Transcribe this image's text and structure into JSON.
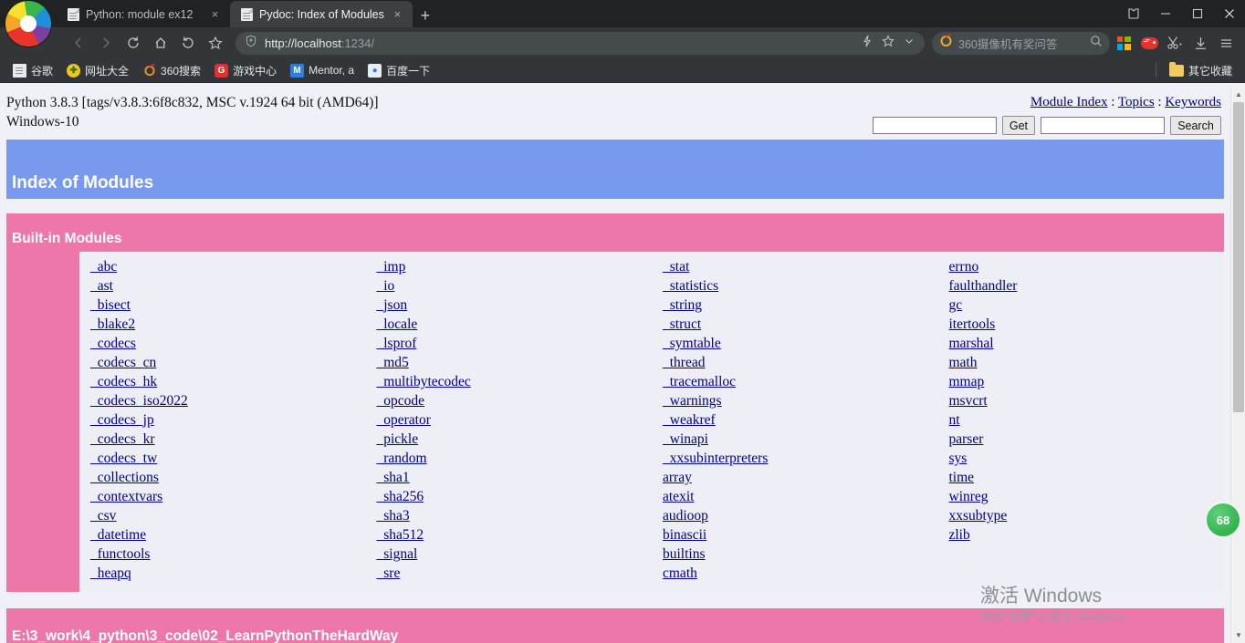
{
  "browser": {
    "tabs": [
      {
        "title": "Python: module ex12",
        "active": false,
        "icon": "document-icon",
        "close_label": "×"
      },
      {
        "title": "Pydoc: Index of Modules",
        "active": true,
        "icon": "document-icon",
        "close_label": "×"
      }
    ],
    "new_tab_label": "+",
    "window_controls": {
      "minimize": "–",
      "maximize": "□",
      "close": "×",
      "collections": "collections-icon"
    },
    "nav": {
      "back": "back-icon",
      "forward": "forward-icon",
      "reload": "reload-icon",
      "home": "home-icon",
      "history": "history-icon",
      "bookmark": "star-icon"
    },
    "omnibox": {
      "shield_icon": "shield-icon",
      "url_protocol": "http://localhost",
      "url_port": ":1234/",
      "full_url": "http://localhost:1234/",
      "right_icons": [
        "lightning-icon",
        "star-icon",
        "chevron-down-icon"
      ]
    },
    "searchbox": {
      "placeholder": "360摄像机有奖问答",
      "engine_icon": "360-search-icon",
      "search_icon": "search-icon"
    },
    "extensions": [
      {
        "name": "microsoft-squares-icon",
        "label": ""
      },
      {
        "name": "game-center-icon",
        "label": ""
      },
      {
        "name": "scissors-icon",
        "label": ""
      },
      {
        "name": "download-icon",
        "label": ""
      },
      {
        "name": "menu-icon",
        "label": ""
      }
    ],
    "bookmarks": [
      {
        "label": "谷歌",
        "icon": "document-icon",
        "color": "#e9eaec"
      },
      {
        "label": "网址大全",
        "icon": "hao123-icon",
        "color": "#f5c518"
      },
      {
        "label": "360搜索",
        "icon": "360-icon",
        "color": "#f58220"
      },
      {
        "label": "游戏中心",
        "icon": "game-icon",
        "color": "#e03030"
      },
      {
        "label": "Mentor, a",
        "icon": "mentor-icon",
        "color": "#2f7fe0"
      },
      {
        "label": "百度一下",
        "icon": "baidu-icon",
        "color": "#3a7fd5"
      }
    ],
    "other_bookmarks": {
      "label": "其它收藏",
      "icon": "folder-icon"
    }
  },
  "content": {
    "version_line1": "Python 3.8.3 [tags/v3.8.3:6f8c832, MSC v.1924 64 bit (AMD64)]",
    "version_line2": "Windows-10",
    "nav_links": [
      {
        "label": "Module Index"
      },
      {
        "label": "Topics"
      },
      {
        "label": "Keywords"
      }
    ],
    "nav_separator": " : ",
    "get_form": {
      "value": "",
      "placeholder": "",
      "button": "Get"
    },
    "search_form": {
      "value": "",
      "placeholder": "",
      "button": "Search"
    },
    "banner_title": "Index of Modules",
    "builtin_section": {
      "title": "Built-in Modules",
      "columns": [
        [
          "_abc",
          "_ast",
          "_bisect",
          "_blake2",
          "_codecs",
          "_codecs_cn",
          "_codecs_hk",
          "_codecs_iso2022",
          "_codecs_jp",
          "_codecs_kr",
          "_codecs_tw",
          "_collections",
          "_contextvars",
          "_csv",
          "_datetime",
          "_functools",
          "_heapq"
        ],
        [
          "_imp",
          "_io",
          "_json",
          "_locale",
          "_lsprof",
          "_md5",
          "_multibytecodec",
          "_opcode",
          "_operator",
          "_pickle",
          "_random",
          "_sha1",
          "_sha256",
          "_sha3",
          "_sha512",
          "_signal",
          "_sre"
        ],
        [
          "_stat",
          "_statistics",
          "_string",
          "_struct",
          "_symtable",
          "_thread",
          "_tracemalloc",
          "_warnings",
          "_weakref",
          "_winapi",
          "_xxsubinterpreters",
          "array",
          "atexit",
          "audioop",
          "binascii",
          "builtins",
          "cmath"
        ],
        [
          "errno",
          "faulthandler",
          "gc",
          "itertools",
          "marshal",
          "math",
          "mmap",
          "msvcrt",
          "nt",
          "parser",
          "sys",
          "time",
          "winreg",
          "xxsubtype",
          "zlib"
        ]
      ]
    },
    "path_section": {
      "title": "E:\\3_work\\4_python\\3_code\\02_LearnPythonTheHardWay"
    },
    "floating_badge": "68",
    "watermark": {
      "line1": "激活 Windows",
      "line2": "转到“设置”以激活 Windows。"
    }
  },
  "colors": {
    "banner_blue": "#7799ee",
    "section_pink": "#ee77aa",
    "content_bg": "#eeeef6",
    "link": "#00008b",
    "page_bg": "#f0f0f8",
    "chrome_bg": "#323639",
    "tabstrip_bg": "#202324"
  }
}
